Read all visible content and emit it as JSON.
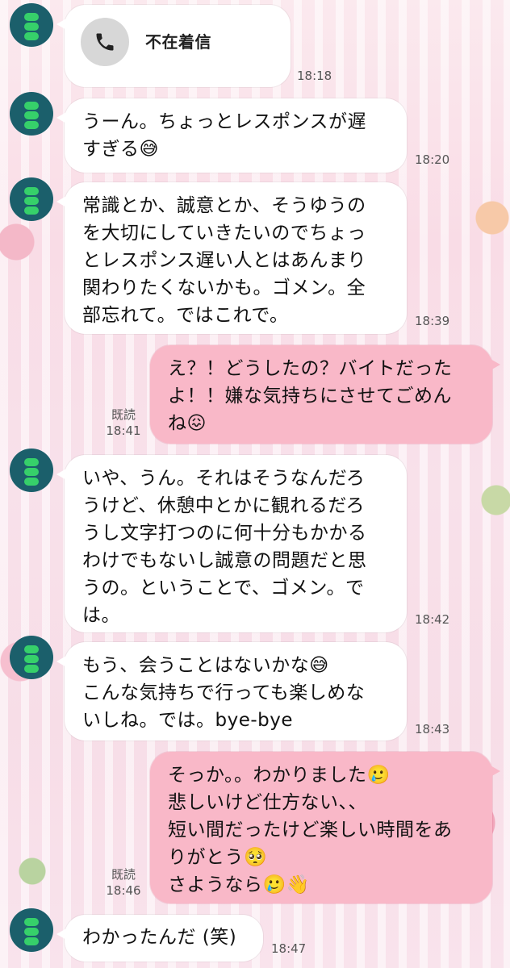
{
  "messages": [
    {
      "side": "left",
      "type": "call",
      "label": "不在着信",
      "time": "18:18",
      "call_icon": "phone-icon"
    },
    {
      "side": "left",
      "text": "うーん。ちょっとレスポンスが遅\nすぎる😅",
      "time": "18:20"
    },
    {
      "side": "left",
      "text": "常識とか、誠意とか、そうゆうの\nを大切にしていきたいのでちょっ\nとレスポンス遅い人とはあんまり\n関わりたくないかも。ゴメン。全\n部忘れて。ではこれで。",
      "time": "18:39"
    },
    {
      "side": "right",
      "text": "え？！どうしたの？バイトだった\nよ！！嫌な気持ちにさせてごめん\nね😖",
      "read": "既読",
      "time": "18:41"
    },
    {
      "side": "left",
      "text": "いや、うん。それはそうなんだろ\nうけど、休憩中とかに観れるだろ\nうし文字打つのに何十分もかかる\nわけでもないし誠意の問題だと思\nうの。ということで、ゴメン。で\nは。",
      "time": "18:42"
    },
    {
      "side": "left",
      "text": "もう、会うことはないかな😅\nこんな気持ちで行っても楽しめな\nいしね。では。bye-bye",
      "time": "18:43"
    },
    {
      "side": "right",
      "text": "そっか。。わかりました🥲\n悲しいけど仕方ない、、\n短い間だったけど楽しい時間をあ\nりがとう🥺\nさようなら🥲👋",
      "read": "既読",
      "time": "18:46"
    },
    {
      "side": "left",
      "text": "わかったんだ (笑)",
      "time": "18:47"
    }
  ],
  "colors": {
    "incoming_bubble": "#ffffff",
    "outgoing_bubble": "#f9b8c8",
    "avatar_bg": "#1b5f6b",
    "avatar_icon": "#36d06a"
  }
}
